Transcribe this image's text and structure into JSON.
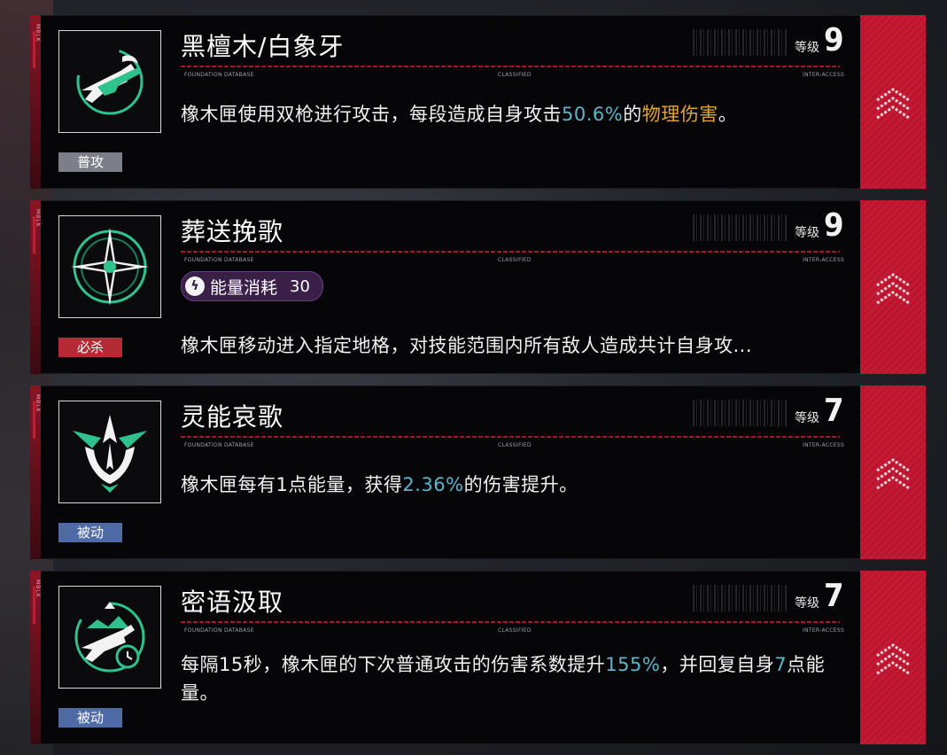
{
  "skills": [
    {
      "title": "黑檀木/白象牙",
      "level_label": "等级",
      "level": "9",
      "type": "普攻",
      "type_color": "#7c7f88",
      "icon": "dual-pistols-icon",
      "micro": [
        "FOUNDATION DATABASE",
        "CLASSIFIED",
        "INTER-ACCESS"
      ],
      "desc": [
        "橡木匣使用双枪进行攻击，每段造成自身攻击",
        "50.6%",
        "的",
        "物理伤害",
        "。"
      ]
    },
    {
      "title": "葬送挽歌",
      "level_label": "等级",
      "level": "9",
      "type": "必杀",
      "type_color": "#b62a36",
      "icon": "compass-star-icon",
      "micro": [
        "FOUNDATION DATABASE",
        "CLASSIFIED",
        "INTER-ACCESS"
      ],
      "energy": {
        "label": "能量消耗",
        "value": "30"
      },
      "desc": [
        "橡木匣移动进入指定地格，对技能范围内所有敌人造成共计自身攻..."
      ]
    },
    {
      "title": "灵能哀歌",
      "level_label": "等级",
      "level": "7",
      "type": "被动",
      "type_color": "#4f6ba6",
      "icon": "trident-arrows-icon",
      "micro": [
        "FOUNDATION DATABASE",
        "CLASSIFIED",
        "INTER-ACCESS"
      ],
      "desc": [
        "橡木匣每有1点能量，获得",
        "2.36%",
        "的伤害提升。"
      ]
    },
    {
      "title": "密语汲取",
      "level_label": "等级",
      "level": "7",
      "type": "被动",
      "type_color": "#4f6ba6",
      "icon": "pistol-clock-icon",
      "micro": [
        "FOUNDATION DATABASE",
        "CLASSIFIED",
        "INTER-ACCESS"
      ],
      "desc": [
        "每隔15秒，橡木匣的下次普通攻击的伤害系数提升",
        "155%",
        "，并回复自身",
        "7",
        "点能量。"
      ]
    }
  ],
  "side_tag": "MBLK",
  "colors": {
    "accent_red": "#c61a33",
    "highlight_blue": "#5fb4c9",
    "highlight_gold": "#e2a23a"
  }
}
